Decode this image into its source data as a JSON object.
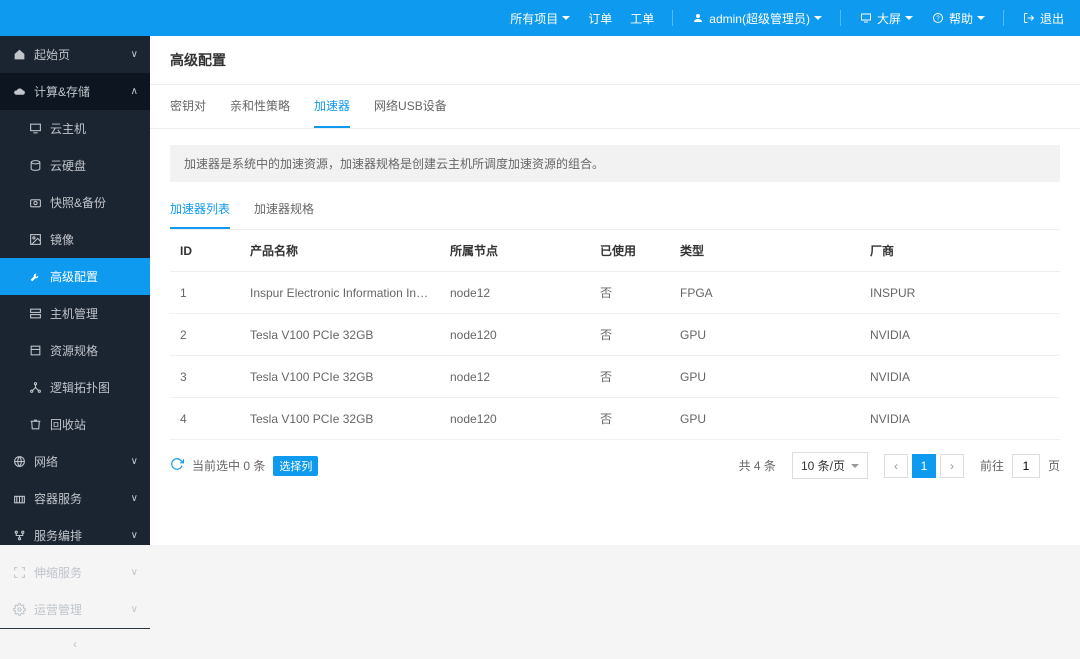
{
  "topbar": {
    "projects": "所有项目",
    "orders": "订单",
    "work_orders": "工单",
    "user": "admin(超级管理员)",
    "big_screen": "大屏",
    "help": "帮助",
    "logout": "退出"
  },
  "sidebar": {
    "items": [
      {
        "label": "起始页",
        "icon": "home"
      },
      {
        "label": "计算&存储",
        "icon": "cloud",
        "expanded": true
      },
      {
        "label": "云主机",
        "icon": "monitor",
        "sub": true
      },
      {
        "label": "云硬盘",
        "icon": "disk",
        "sub": true
      },
      {
        "label": "快照&备份",
        "icon": "camera",
        "sub": true
      },
      {
        "label": "镜像",
        "icon": "image",
        "sub": true
      },
      {
        "label": "高级配置",
        "icon": "wrench",
        "sub": true,
        "active": true
      },
      {
        "label": "主机管理",
        "icon": "server",
        "sub": true
      },
      {
        "label": "资源规格",
        "icon": "spec",
        "sub": true
      },
      {
        "label": "逻辑拓扑图",
        "icon": "topology",
        "sub": true
      },
      {
        "label": "回收站",
        "icon": "trash",
        "sub": true
      },
      {
        "label": "网络",
        "icon": "globe"
      },
      {
        "label": "容器服务",
        "icon": "container"
      },
      {
        "label": "服务编排",
        "icon": "orchestrate"
      },
      {
        "label": "伸缩服务",
        "icon": "scale"
      },
      {
        "label": "运营管理",
        "icon": "ops"
      }
    ]
  },
  "page": {
    "title": "高级配置",
    "tabs": [
      "密钥对",
      "亲和性策略",
      "加速器",
      "网络USB设备"
    ],
    "active_tab": 2,
    "info": "加速器是系统中的加速资源，加速器规格是创建云主机所调度加速资源的组合。",
    "subtabs": [
      "加速器列表",
      "加速器规格"
    ],
    "active_subtab": 0
  },
  "table": {
    "headers": {
      "id": "ID",
      "name": "产品名称",
      "node": "所属节点",
      "used": "已使用",
      "type": "类型",
      "vendor": "厂商"
    },
    "rows": [
      {
        "id": "1",
        "name": "Inspur Electronic Information Industry Co., L...",
        "node": "node12",
        "used": "否",
        "type": "FPGA",
        "vendor": "INSPUR"
      },
      {
        "id": "2",
        "name": "Tesla V100 PCIe 32GB",
        "node": "node120",
        "used": "否",
        "type": "GPU",
        "vendor": "NVIDIA"
      },
      {
        "id": "3",
        "name": "Tesla V100 PCIe 32GB",
        "node": "node12",
        "used": "否",
        "type": "GPU",
        "vendor": "NVIDIA"
      },
      {
        "id": "4",
        "name": "Tesla V100 PCIe 32GB",
        "node": "node120",
        "used": "否",
        "type": "GPU",
        "vendor": "NVIDIA"
      }
    ]
  },
  "footer": {
    "selection": "当前选中 0 条",
    "select_col": "选择列",
    "total": "共 4 条",
    "page_size": "10 条/页",
    "current_page": "1",
    "goto_label": "前往",
    "goto_value": "1",
    "page_suffix": "页"
  }
}
